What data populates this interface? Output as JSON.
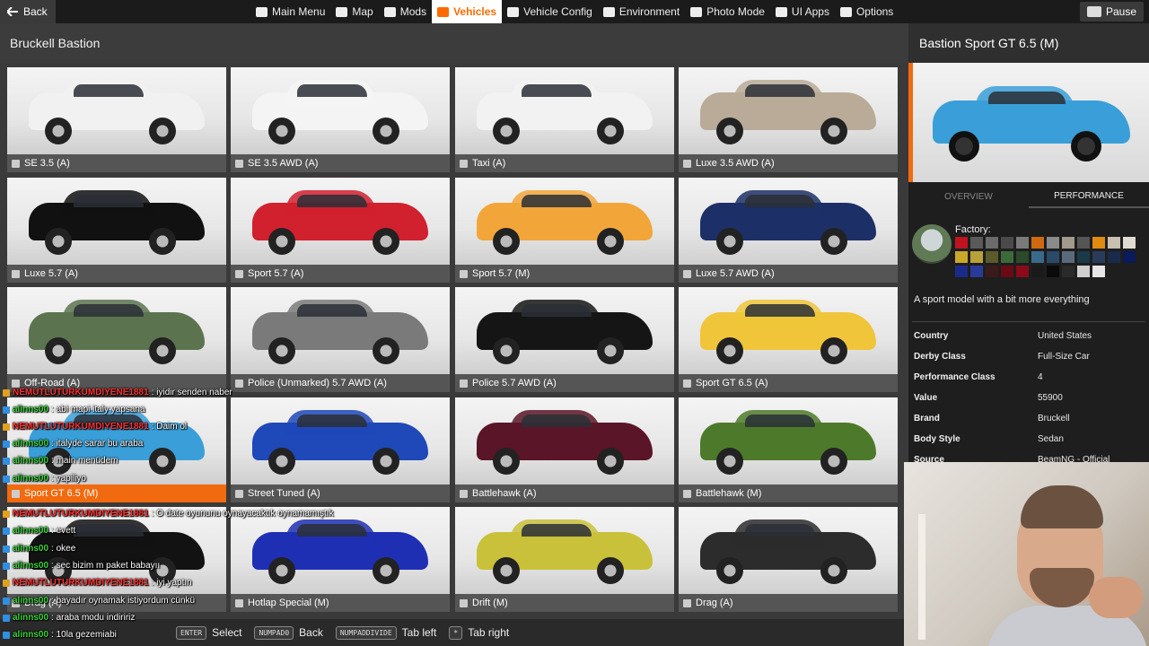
{
  "topbar": {
    "back_label": "Back",
    "nav": [
      {
        "label": "Main Menu",
        "icon": "home-icon"
      },
      {
        "label": "Map",
        "icon": "map-icon"
      },
      {
        "label": "Mods",
        "icon": "puzzle-icon"
      },
      {
        "label": "Vehicles",
        "icon": "car-icon",
        "active": true
      },
      {
        "label": "Vehicle Config",
        "icon": "vehicle-config-icon"
      },
      {
        "label": "Environment",
        "icon": "weather-icon"
      },
      {
        "label": "Photo Mode",
        "icon": "camera-icon"
      },
      {
        "label": "UI Apps",
        "icon": "apps-icon"
      },
      {
        "label": "Options",
        "icon": "sliders-icon"
      }
    ],
    "pause_label": "Pause"
  },
  "left": {
    "title": "Bruckell Bastion",
    "vehicles": [
      {
        "label": "SE 3.5 (A)",
        "color": "#f1f1f1"
      },
      {
        "label": "SE 3.5 AWD (A)",
        "color": "#f4f4f4"
      },
      {
        "label": "Taxi (A)",
        "color": "#f2f2f2"
      },
      {
        "label": "Luxe 3.5 AWD (A)",
        "color": "#b9ab97"
      },
      {
        "label": "Luxe 5.7 (A)",
        "color": "#111111"
      },
      {
        "label": "Sport 5.7 (A)",
        "color": "#d1202e"
      },
      {
        "label": "Sport 5.7 (M)",
        "color": "#f2a63a"
      },
      {
        "label": "Luxe 5.7 AWD (A)",
        "color": "#1c2f66"
      },
      {
        "label": "Off-Road (A)",
        "color": "#5c7350"
      },
      {
        "label": "Police (Unmarked) 5.7 AWD (A)",
        "color": "#7a7a7a"
      },
      {
        "label": "Police 5.7 AWD (A)",
        "color": "#151515"
      },
      {
        "label": "Sport GT 6.5 (A)",
        "color": "#f0c53a"
      },
      {
        "label": "Sport GT 6.5 (M)",
        "color": "#3a9fd8",
        "selected": true
      },
      {
        "label": "Street Tuned (A)",
        "color": "#1f48b8"
      },
      {
        "label": "Battlehawk (A)",
        "color": "#5a1528"
      },
      {
        "label": "Battlehawk (M)",
        "color": "#4d7a2a"
      },
      {
        "label": "Drag (A)",
        "color": "#121212"
      },
      {
        "label": "Hotlap Special (M)",
        "color": "#1f2fb4"
      },
      {
        "label": "Drift (M)",
        "color": "#c9c13a"
      },
      {
        "label": "Drag (A)",
        "color": "#2c2c2c"
      }
    ]
  },
  "right": {
    "title": "Bastion Sport GT 6.5 (M)",
    "tabs": [
      "OVERVIEW",
      "PERFORMANCE"
    ],
    "factory_label": "Factory:",
    "swatches": [
      "#c1121f",
      "#5a5a5a",
      "#6b6b6b",
      "#4a4a4a",
      "#7a7a7a",
      "#d06a10",
      "#8a8a8a",
      "#a39a8c",
      "#555555",
      "#e08a12",
      "#c8c0b0",
      "#e0dcd2",
      "#c9a82a",
      "#b9a13a",
      "#5a5a2a",
      "#3c6a3a",
      "#2a4a2a",
      "#3a6a8a",
      "#2a4a6a",
      "#5a6a7a",
      "#1a3a4a",
      "#2a3a5a",
      "#1a2a4a",
      "#0a1a5a",
      "#1a2a8a",
      "#2a3a9a",
      "#3a1a1a",
      "#6a0a14",
      "#8a0a1a",
      "#1a1a1a",
      "#0a0a0a",
      "#2a2a2a",
      "#cfcfcf",
      "#e6e6e6"
    ],
    "description": "A sport model with a bit more everything",
    "specs": [
      {
        "key": "Country",
        "value": "United States"
      },
      {
        "key": "Derby Class",
        "value": "Full-Size Car"
      },
      {
        "key": "Performance Class",
        "value": "4"
      },
      {
        "key": "Value",
        "value": "55900"
      },
      {
        "key": "Brand",
        "value": "Bruckell"
      },
      {
        "key": "Body Style",
        "value": "Sedan"
      },
      {
        "key": "Source",
        "value": "BeamNG - Official"
      }
    ]
  },
  "hints": [
    {
      "key": "ENTER",
      "label": "Select"
    },
    {
      "key": "NUMPAD0",
      "label": "Back"
    },
    {
      "key": "NUMPADDIVIDE",
      "label": "Tab left"
    },
    {
      "key": "*",
      "label": "Tab right"
    }
  ],
  "chat": [
    {
      "user": "NEMUTLUTURKUMDIYENE1881",
      "user_color": "#ff3030",
      "text": ": iyidir senden naber"
    },
    {
      "user": "alinns00",
      "user_color": "#3ad13a",
      "text": ": abi mapi italy yapsana"
    },
    {
      "user": "NEMUTLUTURKUMDIYENE1881",
      "user_color": "#ff3030",
      "text": ": Daim ol"
    },
    {
      "user": "alinns00",
      "user_color": "#3ad13a",
      "text": ": italyde sarar bu araba"
    },
    {
      "user": "alinns00",
      "user_color": "#3ad13a",
      "text": ": main menüdem"
    },
    {
      "user": "alinns00",
      "user_color": "#3ad13a",
      "text": ": yapiliyo"
    },
    {
      "user": "NEMUTLUTURKUMDIYENE1881",
      "user_color": "#ff3030",
      "text": ": O date oyununu oynayacaktık oynamamıştık"
    },
    {
      "user": "alinns00",
      "user_color": "#3ad13a",
      "text": ": evett"
    },
    {
      "user": "alinns00",
      "user_color": "#3ad13a",
      "text": ": okee"
    },
    {
      "user": "alinns00",
      "user_color": "#3ad13a",
      "text": ": sec bizim m paket babayıı"
    },
    {
      "user": "NEMUTLUTURKUMDIYENE1881",
      "user_color": "#ff3030",
      "text": ": iyi yaptın"
    },
    {
      "user": "alinns00",
      "user_color": "#3ad13a",
      "text": ": bayadır oynamak istiyordum cünkü"
    },
    {
      "user": "alinns00",
      "user_color": "#3ad13a",
      "text": ": araba modu indiririz"
    },
    {
      "user": "alinns00",
      "user_color": "#3ad13a",
      "text": ": 10la gezemiabi"
    }
  ]
}
